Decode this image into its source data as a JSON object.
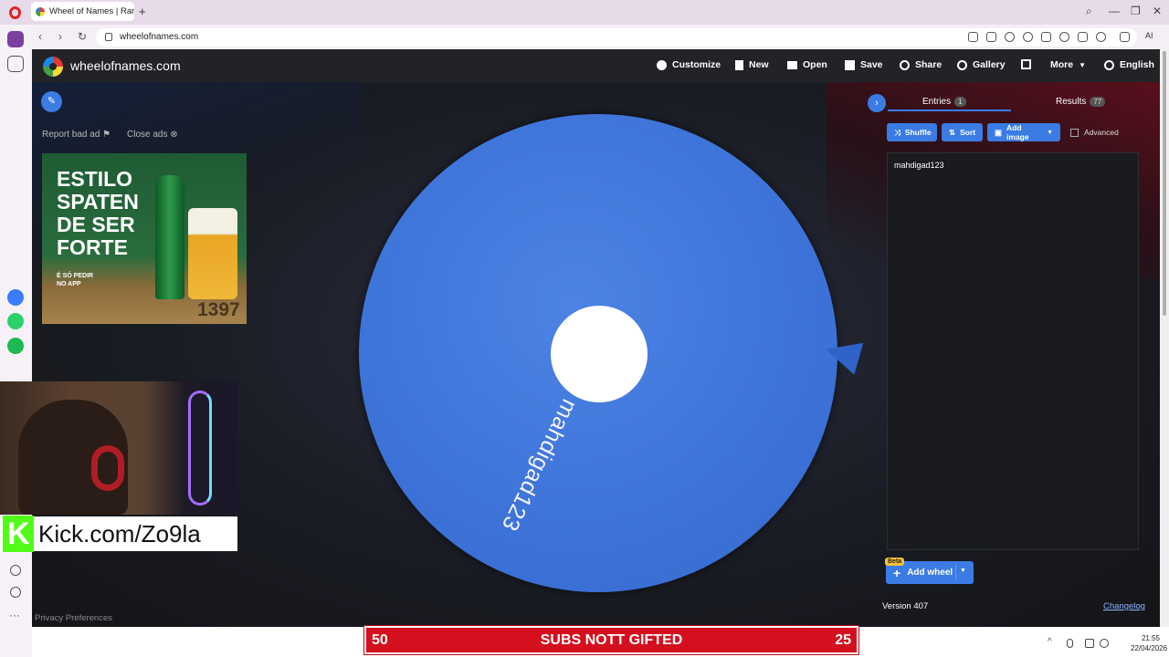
{
  "browser": {
    "tab_title": "Wheel of Names | Rando",
    "new_tab": "+",
    "window_controls": [
      "search-icon",
      "minimize-icon",
      "restore-icon",
      "close-icon"
    ],
    "url": "wheelofnames.com",
    "ai_label": "AI"
  },
  "site": {
    "title": "wheelofnames.com",
    "menu": [
      {
        "label": "Customize",
        "icon": "palette-icon"
      },
      {
        "label": "New",
        "icon": "file-icon"
      },
      {
        "label": "Open",
        "icon": "folder-icon"
      },
      {
        "label": "Save",
        "icon": "save-icon"
      },
      {
        "label": "Share",
        "icon": "share-icon"
      },
      {
        "label": "Gallery",
        "icon": "search-icon"
      },
      {
        "label": "",
        "icon": "fullscreen-icon"
      },
      {
        "label": "More",
        "icon": "chevron-down-icon"
      },
      {
        "label": "English",
        "icon": "globe-icon"
      }
    ]
  },
  "ads": {
    "report": "Report bad ad",
    "close": "Close ads",
    "headline": "ESTILO SPATEN DE SER FORTE",
    "headline_lines": [
      "ESTILO",
      "SPATEN",
      "DE SER",
      "FORTE"
    ],
    "small_lines": [
      "É SÓ PEDIR",
      "NO APP"
    ],
    "number": "1397"
  },
  "wheel": {
    "label": "mahdigad123",
    "color": "#3d73d8"
  },
  "panel": {
    "entries_label": "Entries",
    "entries_count": "1",
    "results_label": "Results",
    "results_count": "77",
    "shuffle": "Shuffle",
    "sort": "Sort",
    "add_image": "Add image",
    "advanced": "Advanced",
    "entries_text": "mahdigad123",
    "beta": "Beta",
    "add_wheel": "Add wheel",
    "version": "Version 407",
    "changelog": "Changelog"
  },
  "footer": {
    "privacy": "Privacy Preferences"
  },
  "stream": {
    "kick_url": "Kick.com/Zo9la",
    "sub_left": "50",
    "sub_center": "SUBS NOTT GIFTED",
    "sub_right": "25"
  },
  "taskbar": {
    "time": "21:55",
    "date": "22/04/2026"
  },
  "colors": {
    "accent": "#3b7be4",
    "kick_green": "#53fc18",
    "sub_bar": "#d4101e"
  }
}
